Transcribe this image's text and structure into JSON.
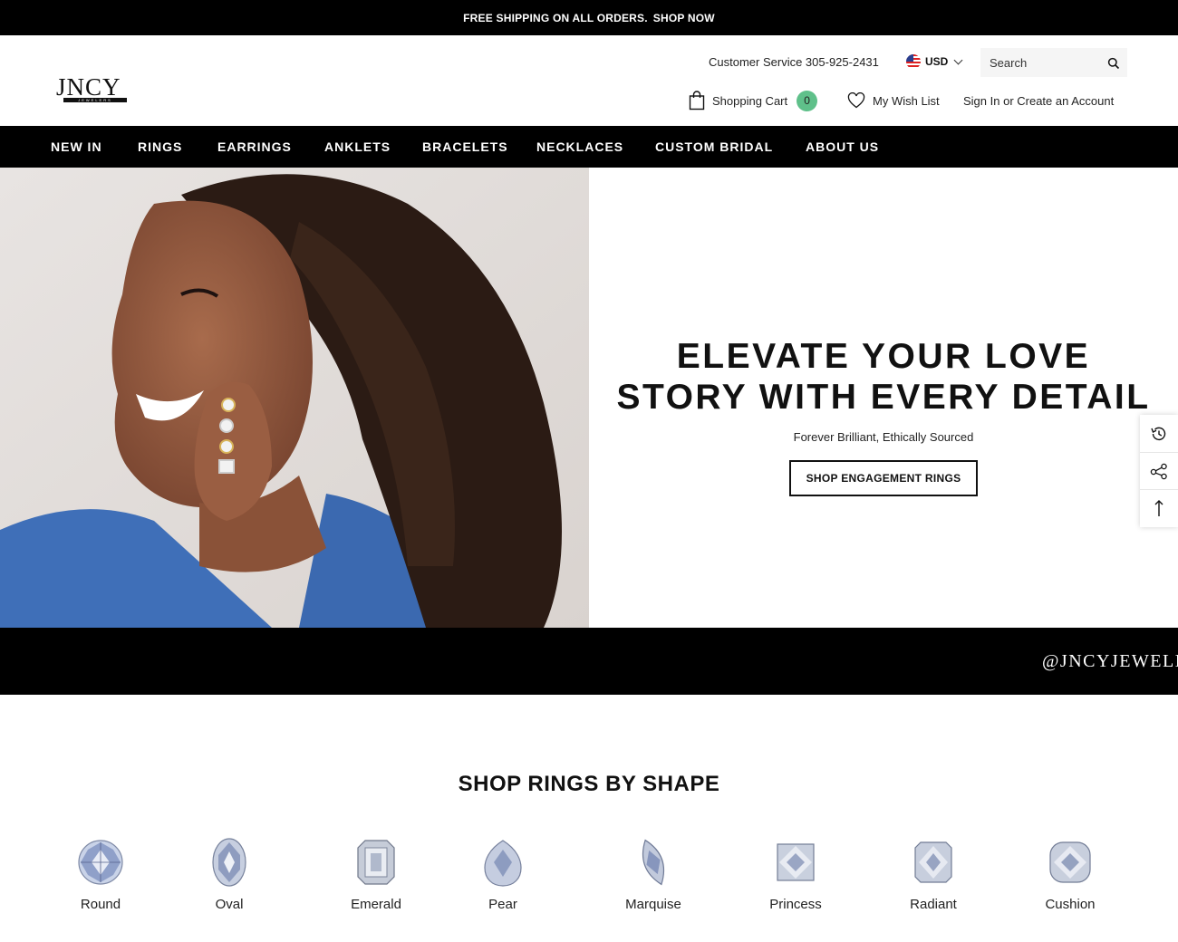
{
  "announcement": {
    "text": "FREE SHIPPING ON ALL ORDERS.",
    "link": "SHOP NOW"
  },
  "header": {
    "logo": {
      "mark": "JNCY",
      "sub": "JEWELERS"
    },
    "customer_service": "Customer Service 305-925-2431",
    "currency": "USD",
    "search_placeholder": "Search",
    "cart_label": "Shopping Cart",
    "cart_count": "0",
    "wishlist_label": "My Wish List",
    "signin_label": "Sign In or Create an Account"
  },
  "nav": {
    "items": [
      "NEW IN",
      "RINGS",
      "EARRINGS",
      "ANKLETS",
      "BRACELETS",
      "NECKLACES",
      "CUSTOM BRIDAL",
      "ABOUT US"
    ]
  },
  "hero": {
    "title_line1": "ELEVATE YOUR LOVE",
    "title_line2": "STORY WITH EVERY DETAIL",
    "subtitle": "Forever Brilliant, Ethically Sourced",
    "button": "SHOP ENGAGEMENT RINGS"
  },
  "instagram_handle": "@JNCYJEWELERS",
  "shapes": {
    "title": "SHOP RINGS BY SHAPE",
    "items": [
      "Round",
      "Oval",
      "Emerald",
      "Pear",
      "Marquise",
      "Princess",
      "Radiant",
      "Cushion"
    ]
  },
  "colors": {
    "accent_badge": "#5fc08a",
    "bar": "#000000"
  }
}
